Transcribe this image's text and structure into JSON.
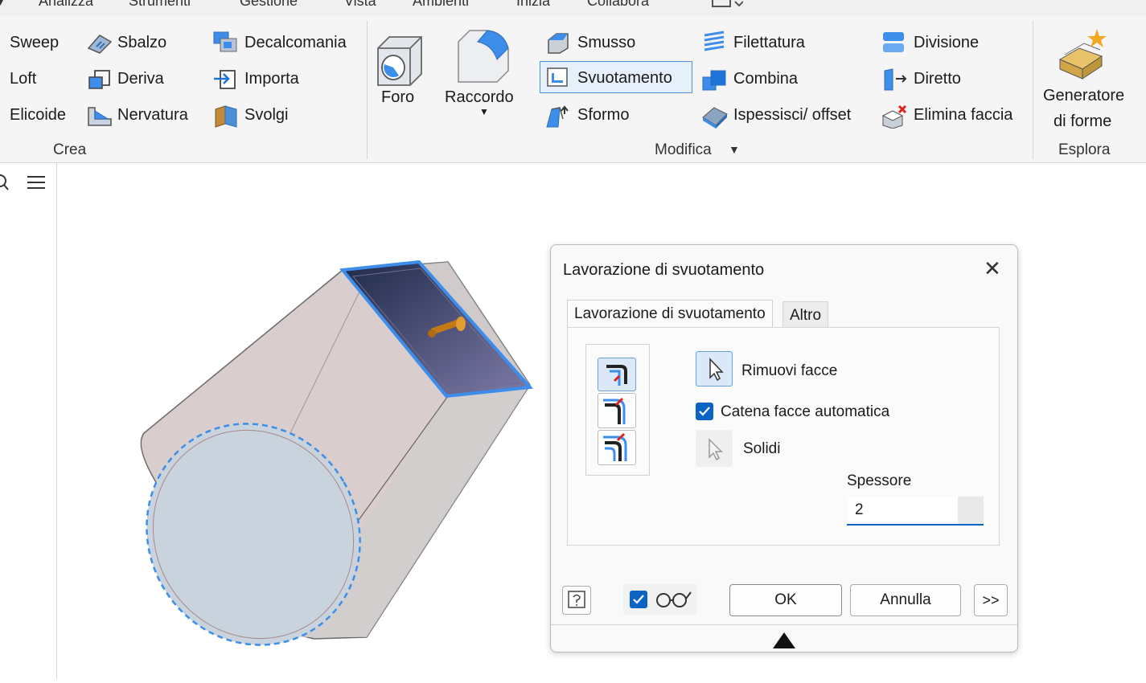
{
  "menu": {
    "items": [
      "Analizza",
      "Strumenti",
      "Gestione",
      "Vista",
      "Ambienti",
      "Inizia",
      "Collabora"
    ]
  },
  "ribbon": {
    "crea": {
      "col1": [
        "Sweep",
        "Loft",
        "Elicoide"
      ],
      "col2": [
        "Sbalzo",
        "Deriva",
        "Nervatura"
      ],
      "col3": [
        "Decalcomania",
        "Importa",
        "Svolgi"
      ],
      "group_label": "Crea"
    },
    "modifica": {
      "foro": "Foro",
      "raccordo": "Raccordo",
      "col1": [
        "Smusso",
        "Svuotamento",
        "Sformo"
      ],
      "col2": [
        "Filettatura",
        "Combina",
        "Ispessisci/ offset"
      ],
      "col3": [
        "Divisione",
        "Diretto",
        "Elimina faccia"
      ],
      "group_label": "Modifica"
    },
    "esplora": {
      "generator_line1": "Generatore",
      "generator_line2": "di forme",
      "group_label": "Esplora"
    }
  },
  "dialog": {
    "title": "Lavorazione di svuotamento",
    "tabs": [
      "Lavorazione di svuotamento",
      "Altro"
    ],
    "remove_faces_label": "Rimuovi facce",
    "auto_chain_label": "Catena facce automatica",
    "auto_chain_checked": true,
    "solids_label": "Solidi",
    "thickness_label": "Spessore",
    "thickness_value": "2",
    "ok_label": "OK",
    "cancel_label": "Annulla",
    "more_label": ">>",
    "preview_checked": true
  },
  "colors": {
    "accent": "#0b63c4",
    "selection": "#3c8eea",
    "ribbon_bg": "#f5f5f5"
  }
}
